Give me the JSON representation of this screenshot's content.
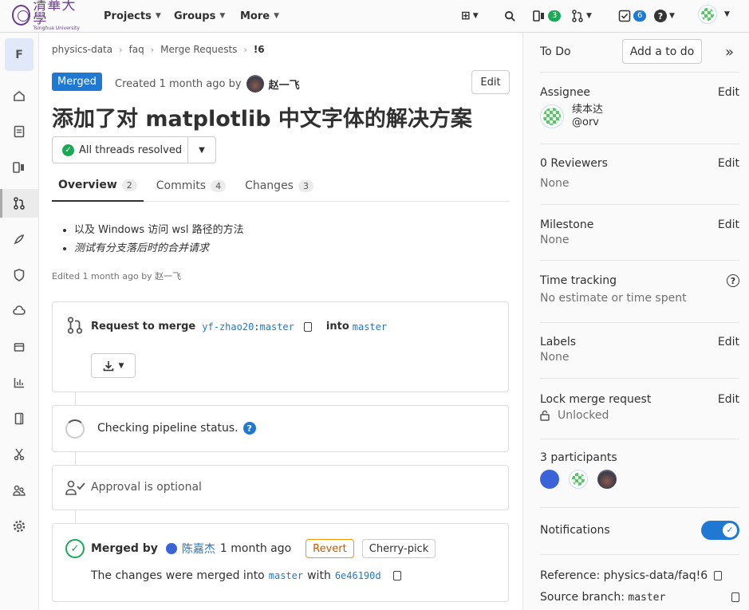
{
  "topbar": {
    "logo_cn": "清華大學",
    "logo_en": "Tsinghua University",
    "nav": [
      "Projects",
      "Groups",
      "More"
    ],
    "issues_count": "3",
    "todos_count": "6"
  },
  "sidebar": {
    "project_letter": "F"
  },
  "breadcrumb": [
    "physics-data",
    "faq",
    "Merge Requests",
    "!6"
  ],
  "mr": {
    "status": "Merged",
    "created_text": "Created 1 month ago by",
    "author": "赵一飞",
    "edit_label": "Edit",
    "title": "添加了对 matplotlib 中文字体的解决方案",
    "threads_label": "All threads resolved",
    "tabs": [
      {
        "label": "Overview",
        "count": "2"
      },
      {
        "label": "Commits",
        "count": "4"
      },
      {
        "label": "Changes",
        "count": "3"
      }
    ],
    "description": [
      "以及 Windows 访问 wsl 路径的方法",
      "测试有分支落后时的合并请求"
    ],
    "edited_text": "Edited 1 month ago by 赵一飞"
  },
  "widget": {
    "request_label": "Request to merge",
    "source_ns": "yf-zhao20",
    "source_branch": "master",
    "into_label": "into",
    "target_branch": "master",
    "pipeline_text": "Checking pipeline status.",
    "approval_text": "Approval is optional",
    "merged_by_label": "Merged by",
    "merged_by_user": "陈嘉杰",
    "merged_time": "1 month ago",
    "revert_label": "Revert",
    "cherry_label": "Cherry-pick",
    "merged_into_text": "The changes were merged into",
    "merged_branch": "master",
    "with_label": "with",
    "commit_sha": "6e46190d"
  },
  "right_sidebar": {
    "todo_label": "To Do",
    "add_todo_label": "Add a to do",
    "assignee_label": "Assignee",
    "assignee_name": "续本达",
    "assignee_handle": "@orv",
    "reviewers_label": "0 Reviewers",
    "reviewers_value": "None",
    "milestone_label": "Milestone",
    "milestone_value": "None",
    "time_label": "Time tracking",
    "time_value": "No estimate or time spent",
    "labels_label": "Labels",
    "labels_value": "None",
    "lock_label": "Lock merge request",
    "lock_value": "Unlocked",
    "participants_label": "3 participants",
    "notifications_label": "Notifications",
    "notifications_on": true,
    "reference_text": "Reference: physics-data/faq!6",
    "source_label": "Source branch:",
    "source_value": "master",
    "edit_label": "Edit"
  },
  "colors": {
    "accent": "#1f78d1",
    "success": "#1aaa55",
    "revert": "#fc9403"
  }
}
